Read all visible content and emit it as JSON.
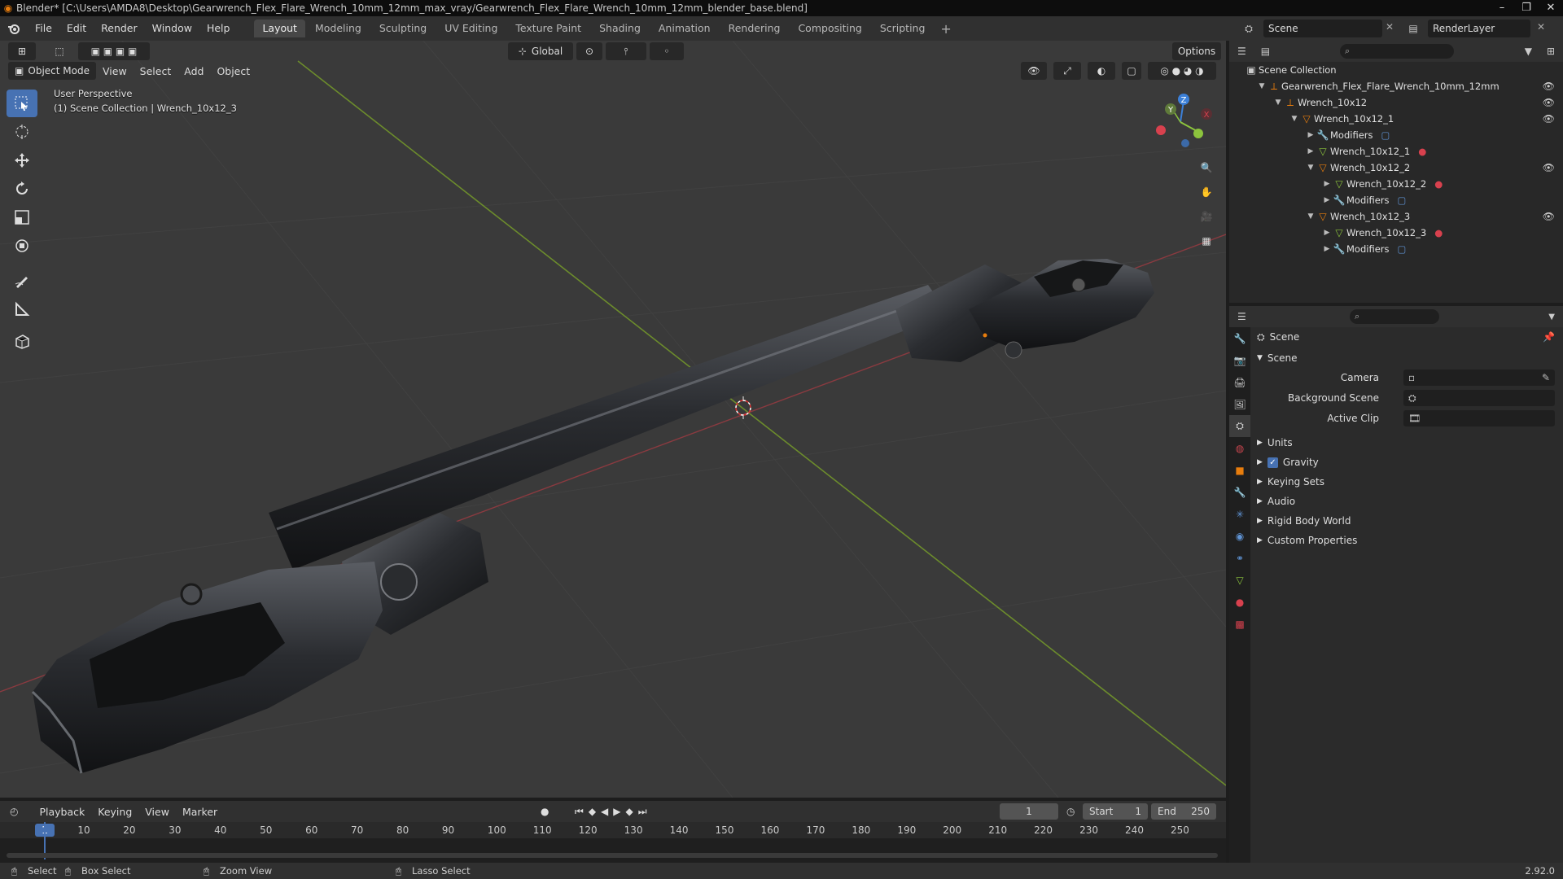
{
  "window": {
    "title": "Blender* [C:\\Users\\AMDA8\\Desktop\\Gearwrench_Flex_Flare_Wrench_10mm_12mm_max_vray/Gearwrench_Flex_Flare_Wrench_10mm_12mm_blender_base.blend]",
    "controls": [
      "–",
      "❐",
      "✕"
    ]
  },
  "menu": {
    "items": [
      "File",
      "Edit",
      "Render",
      "Window",
      "Help"
    ]
  },
  "workspaces": {
    "tabs": [
      "Layout",
      "Modeling",
      "Sculpting",
      "UV Editing",
      "Texture Paint",
      "Shading",
      "Animation",
      "Rendering",
      "Compositing",
      "Scripting"
    ],
    "active": "Layout",
    "add": "+"
  },
  "scene_selector": {
    "scene": "Scene",
    "view_layer": "RenderLayer"
  },
  "viewport": {
    "mode": "Object Mode",
    "menus": [
      "View",
      "Select",
      "Add",
      "Object"
    ],
    "orientation": "Global",
    "options_label": "Options",
    "perspective_label": "User Perspective",
    "collection_label": "(1) Scene Collection | Wrench_10x12_3",
    "gizmo_axes": {
      "x": "X",
      "y": "Y",
      "z": "Z"
    }
  },
  "outliner": {
    "root": "Scene Collection",
    "rows": [
      {
        "label": "Gearwrench_Flex_Flare_Wrench_10mm_12mm",
        "icon": "empty-icon",
        "level": 1,
        "tri": "▼",
        "eye": true
      },
      {
        "label": "Wrench_10x12",
        "icon": "empty-icon",
        "level": 2,
        "tri": "▼",
        "eye": true
      },
      {
        "label": "Wrench_10x12_1",
        "icon": "object-icon",
        "level": 3,
        "tri": "▼",
        "eye": true
      },
      {
        "label": "Modifiers",
        "icon": "wrench-icon",
        "level": 4,
        "tri": "▶",
        "eye": false
      },
      {
        "label": "Wrench_10x12_1",
        "icon": "mesh-icon",
        "level": 4,
        "tri": "▶",
        "eye": false
      },
      {
        "label": "Wrench_10x12_2",
        "icon": "object-icon",
        "level": 4,
        "tri": "▼",
        "eye": true
      },
      {
        "label": "Wrench_10x12_2",
        "icon": "mesh-icon",
        "level": 5,
        "tri": "▶",
        "eye": false
      },
      {
        "label": "Modifiers",
        "icon": "wrench-icon",
        "level": 5,
        "tri": "▶",
        "eye": false
      },
      {
        "label": "Wrench_10x12_3",
        "icon": "object-icon",
        "level": 4,
        "tri": "▼",
        "eye": true
      },
      {
        "label": "Wrench_10x12_3",
        "icon": "mesh-icon",
        "level": 5,
        "tri": "▶",
        "eye": false
      },
      {
        "label": "Modifiers",
        "icon": "wrench-icon",
        "level": 5,
        "tri": "▶",
        "eye": false
      }
    ]
  },
  "properties": {
    "context_label": "Scene",
    "section": "Scene",
    "fields": [
      {
        "label": "Camera",
        "value": ""
      },
      {
        "label": "Background Scene",
        "value": ""
      },
      {
        "label": "Active Clip",
        "value": ""
      }
    ],
    "panels": [
      "Units",
      "Gravity",
      "Keying Sets",
      "Audio",
      "Rigid Body World",
      "Custom Properties"
    ],
    "gravity_checked": true
  },
  "timeline": {
    "menus": [
      "Playback",
      "Keying",
      "View",
      "Marker"
    ],
    "current_frame": "1",
    "start_label": "Start",
    "start_value": "1",
    "end_label": "End",
    "end_value": "250",
    "ticks": [
      "1",
      "10",
      "20",
      "30",
      "40",
      "50",
      "60",
      "70",
      "80",
      "90",
      "100",
      "110",
      "120",
      "130",
      "140",
      "150",
      "160",
      "170",
      "180",
      "190",
      "200",
      "210",
      "220",
      "230",
      "240",
      "250"
    ]
  },
  "statusbar": {
    "select": "Select",
    "box_select": "Box Select",
    "zoom_view": "Zoom View",
    "lasso_select": "Lasso Select",
    "version": "2.92.0"
  },
  "colors": {
    "accent": "#4772b3",
    "x_axis": "#d8414e",
    "y_axis": "#8cc43d",
    "z_axis": "#3c80d8",
    "blender_orange": "#e87d0d"
  }
}
